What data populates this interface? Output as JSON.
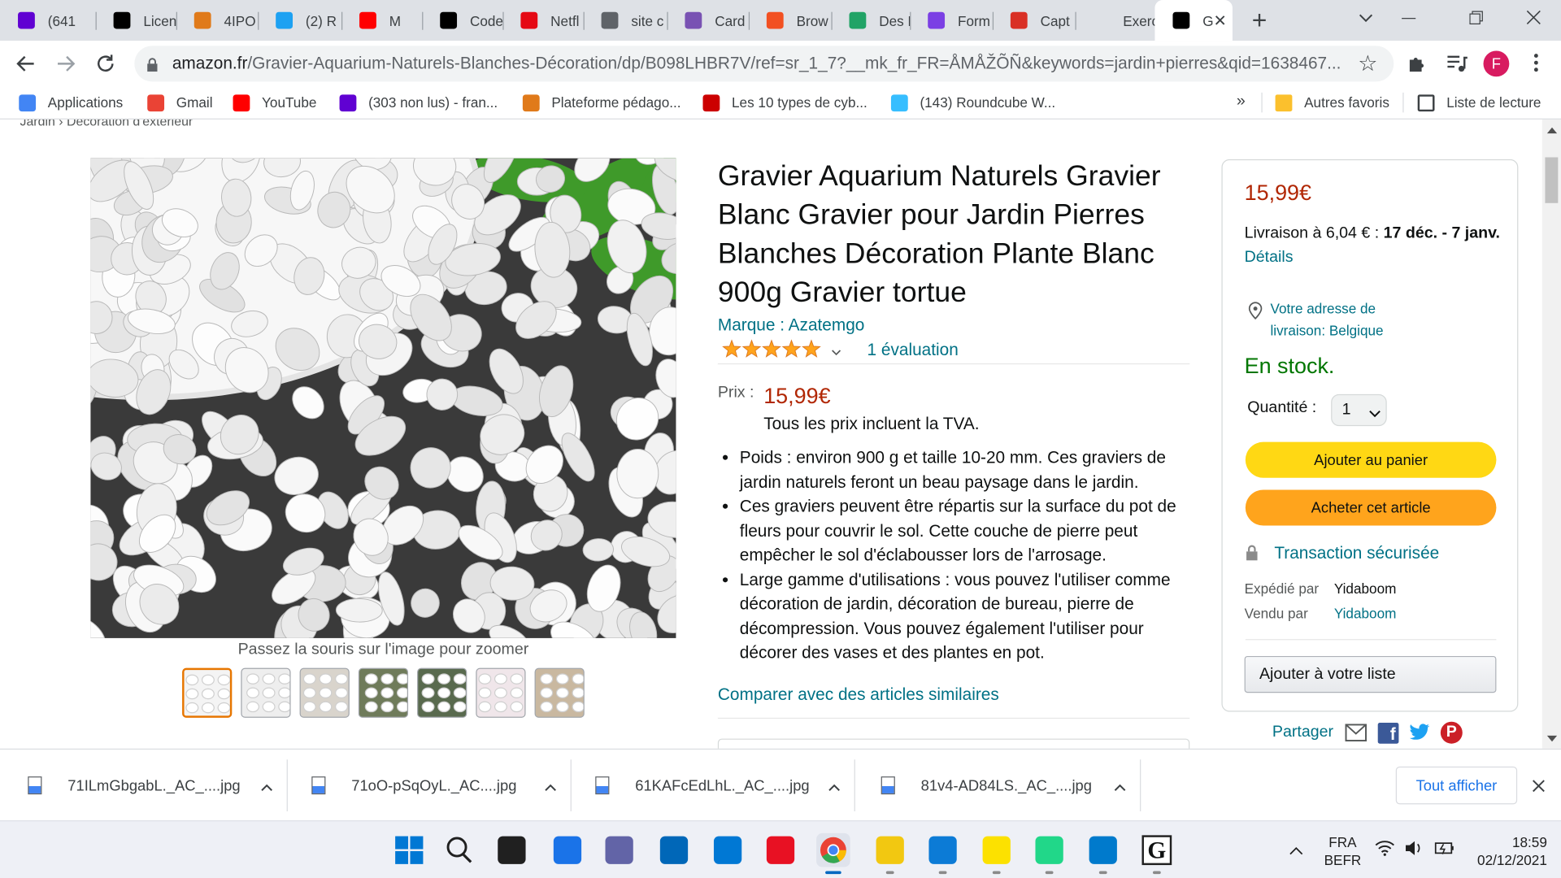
{
  "browser": {
    "tabs": [
      {
        "label": "(641",
        "icon": "mail-icon",
        "color": "#6001d2"
      },
      {
        "label": "Licen",
        "icon": "jb-icon",
        "color": "#000000"
      },
      {
        "label": "4IPO",
        "icon": "fm-icon",
        "color": "#e07a1a"
      },
      {
        "label": "(2) R",
        "icon": "bird-icon",
        "color": "#1da1f2"
      },
      {
        "label": "M",
        "icon": "youtube-icon",
        "color": "#ff0000"
      },
      {
        "label": "Code",
        "icon": "codepen-icon",
        "color": "#000000"
      },
      {
        "label": "Netfl",
        "icon": "netflix-icon",
        "color": "#e50914"
      },
      {
        "label": "site c",
        "icon": "globe-icon",
        "color": "#5f6368"
      },
      {
        "label": "Card",
        "icon": "bootstrap-icon",
        "color": "#7952b3"
      },
      {
        "label": "Brow",
        "icon": "windows-icon",
        "color": "#f25022"
      },
      {
        "label": "Des F",
        "icon": "px-icon",
        "color": "#21a366"
      },
      {
        "label": "Form",
        "icon": "form-icon",
        "color": "#7b3fe4"
      },
      {
        "label": "Capt",
        "icon": "capture-icon",
        "color": "#d93025"
      },
      {
        "label": "Exerc",
        "icon": "blank-icon",
        "color": "#dee1e6"
      },
      {
        "label": "G",
        "icon": "amazon-icon",
        "color": "#000000"
      }
    ],
    "url_host": "amazon.fr",
    "url_path": "/Gravier-Aquarium-Naturels-Blanches-Décoration/dp/B098LHBR7V/ref=sr_1_7?__mk_fr_FR=ÅMÅŽÕÑ&keywords=jardin+pierres&qid=1638467...",
    "profile_initial": "F",
    "profile_color": "#d81b60"
  },
  "bookmarks": [
    {
      "label": "Applications",
      "icon": "apps-icon",
      "color": "#4285f4"
    },
    {
      "label": "Gmail",
      "icon": "gmail-icon",
      "color": "#ea4335"
    },
    {
      "label": "YouTube",
      "icon": "youtube-icon",
      "color": "#ff0000"
    },
    {
      "label": "(303 non lus) - fran...",
      "icon": "mail-icon",
      "color": "#6001d2"
    },
    {
      "label": "Plateforme pédago...",
      "icon": "fm-icon",
      "color": "#e07a1a"
    },
    {
      "label": "Les 10 types de cyb...",
      "icon": "norton-icon",
      "color": "#cc0000"
    },
    {
      "label": "(143) Roundcube W...",
      "icon": "roundcube-icon",
      "color": "#37beff"
    }
  ],
  "bookmarks_overflow": "»",
  "bookmarks_other": "Autres favoris",
  "bookmarks_reading": "Liste de lecture",
  "product": {
    "breadcrumb": "Jardin › Décoration d'extérieur",
    "title": "Gravier Aquarium Naturels Gravier Blanc Gravier pour Jardin Pierres Blanches Décoration Plante Blanc 900g Gravier tortue",
    "brand": "Marque : Azatemgo",
    "rating_stars": 5,
    "rating_count": "1 évaluation",
    "price_label": "Prix :",
    "price": "15,99€",
    "tax_note": "Tous les prix incluent la TVA.",
    "bullets": [
      "Poids : environ 900 g et taille 10-20 mm. Ces graviers de jardin naturels feront un beau paysage dans le jardin.",
      "Ces graviers peuvent être répartis sur la surface du pot de fleurs pour couvrir le sol. Cette couche de pierre peut empêcher le sol d'éclabousser lors de l'arrosage.",
      "Large gamme d'utilisations : vous pouvez l'utiliser comme décoration de jardin, décoration de bureau, pierre de décompression. Vous pouvez également l'utiliser pour décorer des vases et des plantes en pot."
    ],
    "compare_link": "Comparer avec des articles similaires",
    "zoom_hint": "Passez la souris sur l'image pour zoomer",
    "thumbnail_count": 7
  },
  "buybox": {
    "price": "15,99€",
    "delivery_prefix": "Livraison à 6,04 € : ",
    "delivery_dates": "17 déc. - 7 janv.",
    "delivery_details": "Détails",
    "address_line1": "Votre adresse de",
    "address_line2": "livraison: Belgique",
    "stock": "En stock.",
    "qty_label": "Quantité :",
    "qty_value": "1",
    "add_cart": "Ajouter au panier",
    "buy_now": "Acheter cet article",
    "secure": "Transaction sécurisée",
    "shipped_label": "Expédié par",
    "shipped_value": "Yidaboom",
    "sold_label": "Vendu par",
    "sold_value": "Yidaboom",
    "add_list": "Ajouter à votre liste",
    "share": "Partager"
  },
  "downloads": {
    "files": [
      "71ILmGbgabL._AC_....jpg",
      "71oO-pSqOyL._AC....jpg",
      "61KAFcEdLhL._AC_....jpg",
      "81v4-AD84LS._AC_....jpg"
    ],
    "show_all": "Tout afficher"
  },
  "taskbar": {
    "lang1": "FRA",
    "lang2": "BEFR",
    "time": "18:59",
    "date": "02/12/2021"
  }
}
